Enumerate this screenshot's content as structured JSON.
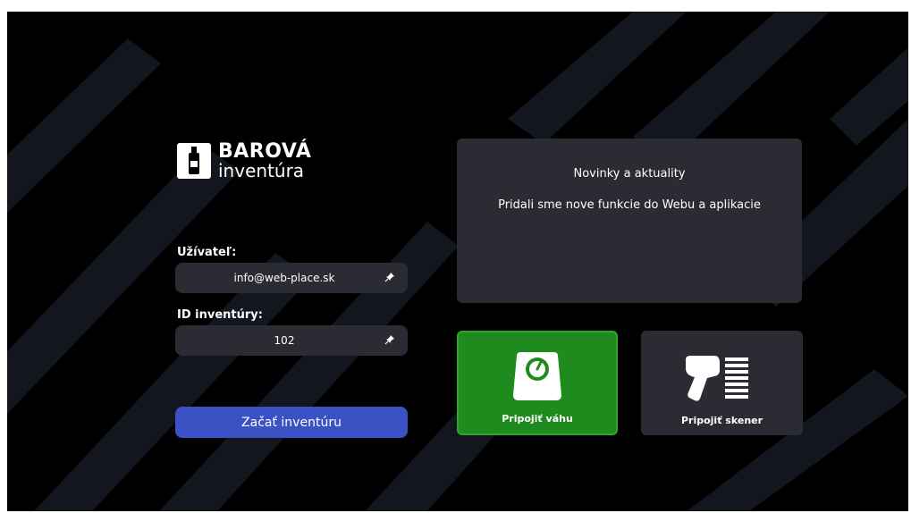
{
  "logo": {
    "line1": "BAROVÁ",
    "line2": "inventúra"
  },
  "login": {
    "user_label": "Užívateľ:",
    "user_value": "info@web-place.sk",
    "inventory_label": "ID inventúry:",
    "inventory_value": "102",
    "start_label": "Začať inventúru"
  },
  "news": {
    "title": "Novinky a aktuality",
    "text": "Pridali sme nove funkcie do Webu a aplikacie"
  },
  "tiles": {
    "scale_label": "Pripojiť váhu",
    "scanner_label": "Pripojiť skener"
  },
  "colors": {
    "background": "#000000",
    "panel": "#2b2b33",
    "primary_button": "#3b52c4",
    "active_tile": "#1f8a1e"
  },
  "icons": [
    "bottle-logo-icon",
    "pin-icon",
    "scale-icon",
    "barcode-scanner-icon"
  ]
}
